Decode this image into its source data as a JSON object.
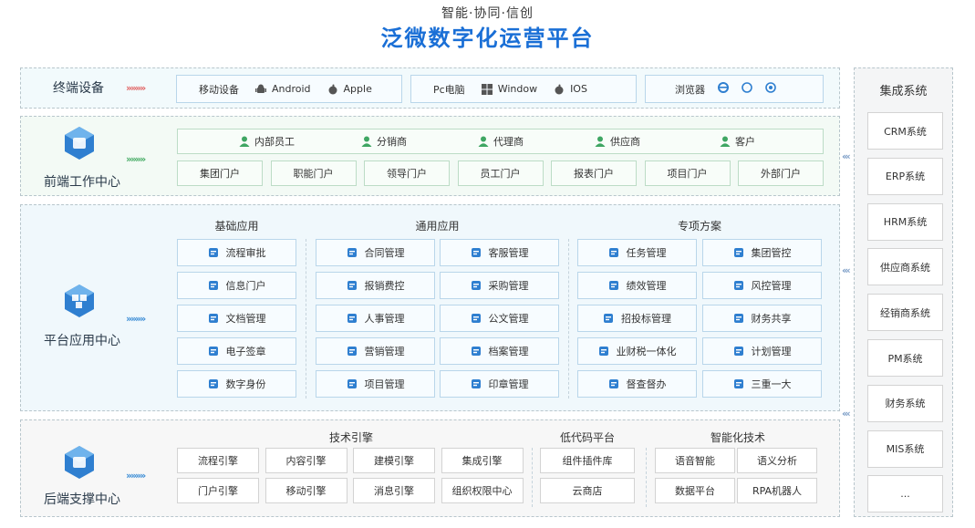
{
  "header": {
    "slogan": "智能·协同·信创",
    "title": "泛微数字化运营平台"
  },
  "device": {
    "label": "终端设备",
    "mobile": {
      "label": "移动设备",
      "items": [
        "Android",
        "Apple"
      ]
    },
    "pc": {
      "label": "Pc电脑",
      "items": [
        "Window",
        "IOS"
      ]
    },
    "browser": {
      "label": "浏览器"
    }
  },
  "front": {
    "label": "前端工作中心",
    "roles": [
      "内部员工",
      "分销商",
      "代理商",
      "供应商",
      "客户"
    ],
    "portals": [
      "集团门户",
      "职能门户",
      "领导门户",
      "员工门户",
      "报表门户",
      "项目门户",
      "外部门户"
    ]
  },
  "platform": {
    "label": "平台应用中心",
    "basic": {
      "heading": "基础应用",
      "items": [
        "流程审批",
        "信息门户",
        "文档管理",
        "电子签章",
        "数字身份"
      ]
    },
    "general": {
      "heading": "通用应用",
      "items": [
        "合同管理",
        "客服管理",
        "报销费控",
        "采购管理",
        "人事管理",
        "公文管理",
        "营销管理",
        "档案管理",
        "项目管理",
        "印章管理"
      ]
    },
    "special": {
      "heading": "专项方案",
      "items": [
        "任务管理",
        "集团管控",
        "绩效管理",
        "风控管理",
        "招投标管理",
        "财务共享",
        "业财税一体化",
        "计划管理",
        "督查督办",
        "三重一大"
      ]
    }
  },
  "backend": {
    "label": "后端支撑中心",
    "tech": {
      "heading": "技术引擎",
      "items": [
        "流程引擎",
        "内容引擎",
        "建模引擎",
        "集成引擎",
        "门户引擎",
        "移动引擎",
        "消息引擎",
        "组织权限中心"
      ]
    },
    "lowcode": {
      "heading": "低代码平台",
      "items": [
        "组件插件库",
        "云商店"
      ]
    },
    "ai": {
      "heading": "智能化技术",
      "items": [
        "语音智能",
        "语义分析",
        "数据平台",
        "RPA机器人"
      ]
    }
  },
  "integration": {
    "heading": "集成系统",
    "items": [
      "CRM系统",
      "ERP系统",
      "HRM系统",
      "供应商系统",
      "经销商系统",
      "PM系统",
      "财务系统",
      "MIS系统",
      "..."
    ]
  },
  "colors": {
    "title_blue": "#1a6fd6",
    "icon_blue": "#2f7fd0",
    "icon_green": "#3fa663"
  }
}
